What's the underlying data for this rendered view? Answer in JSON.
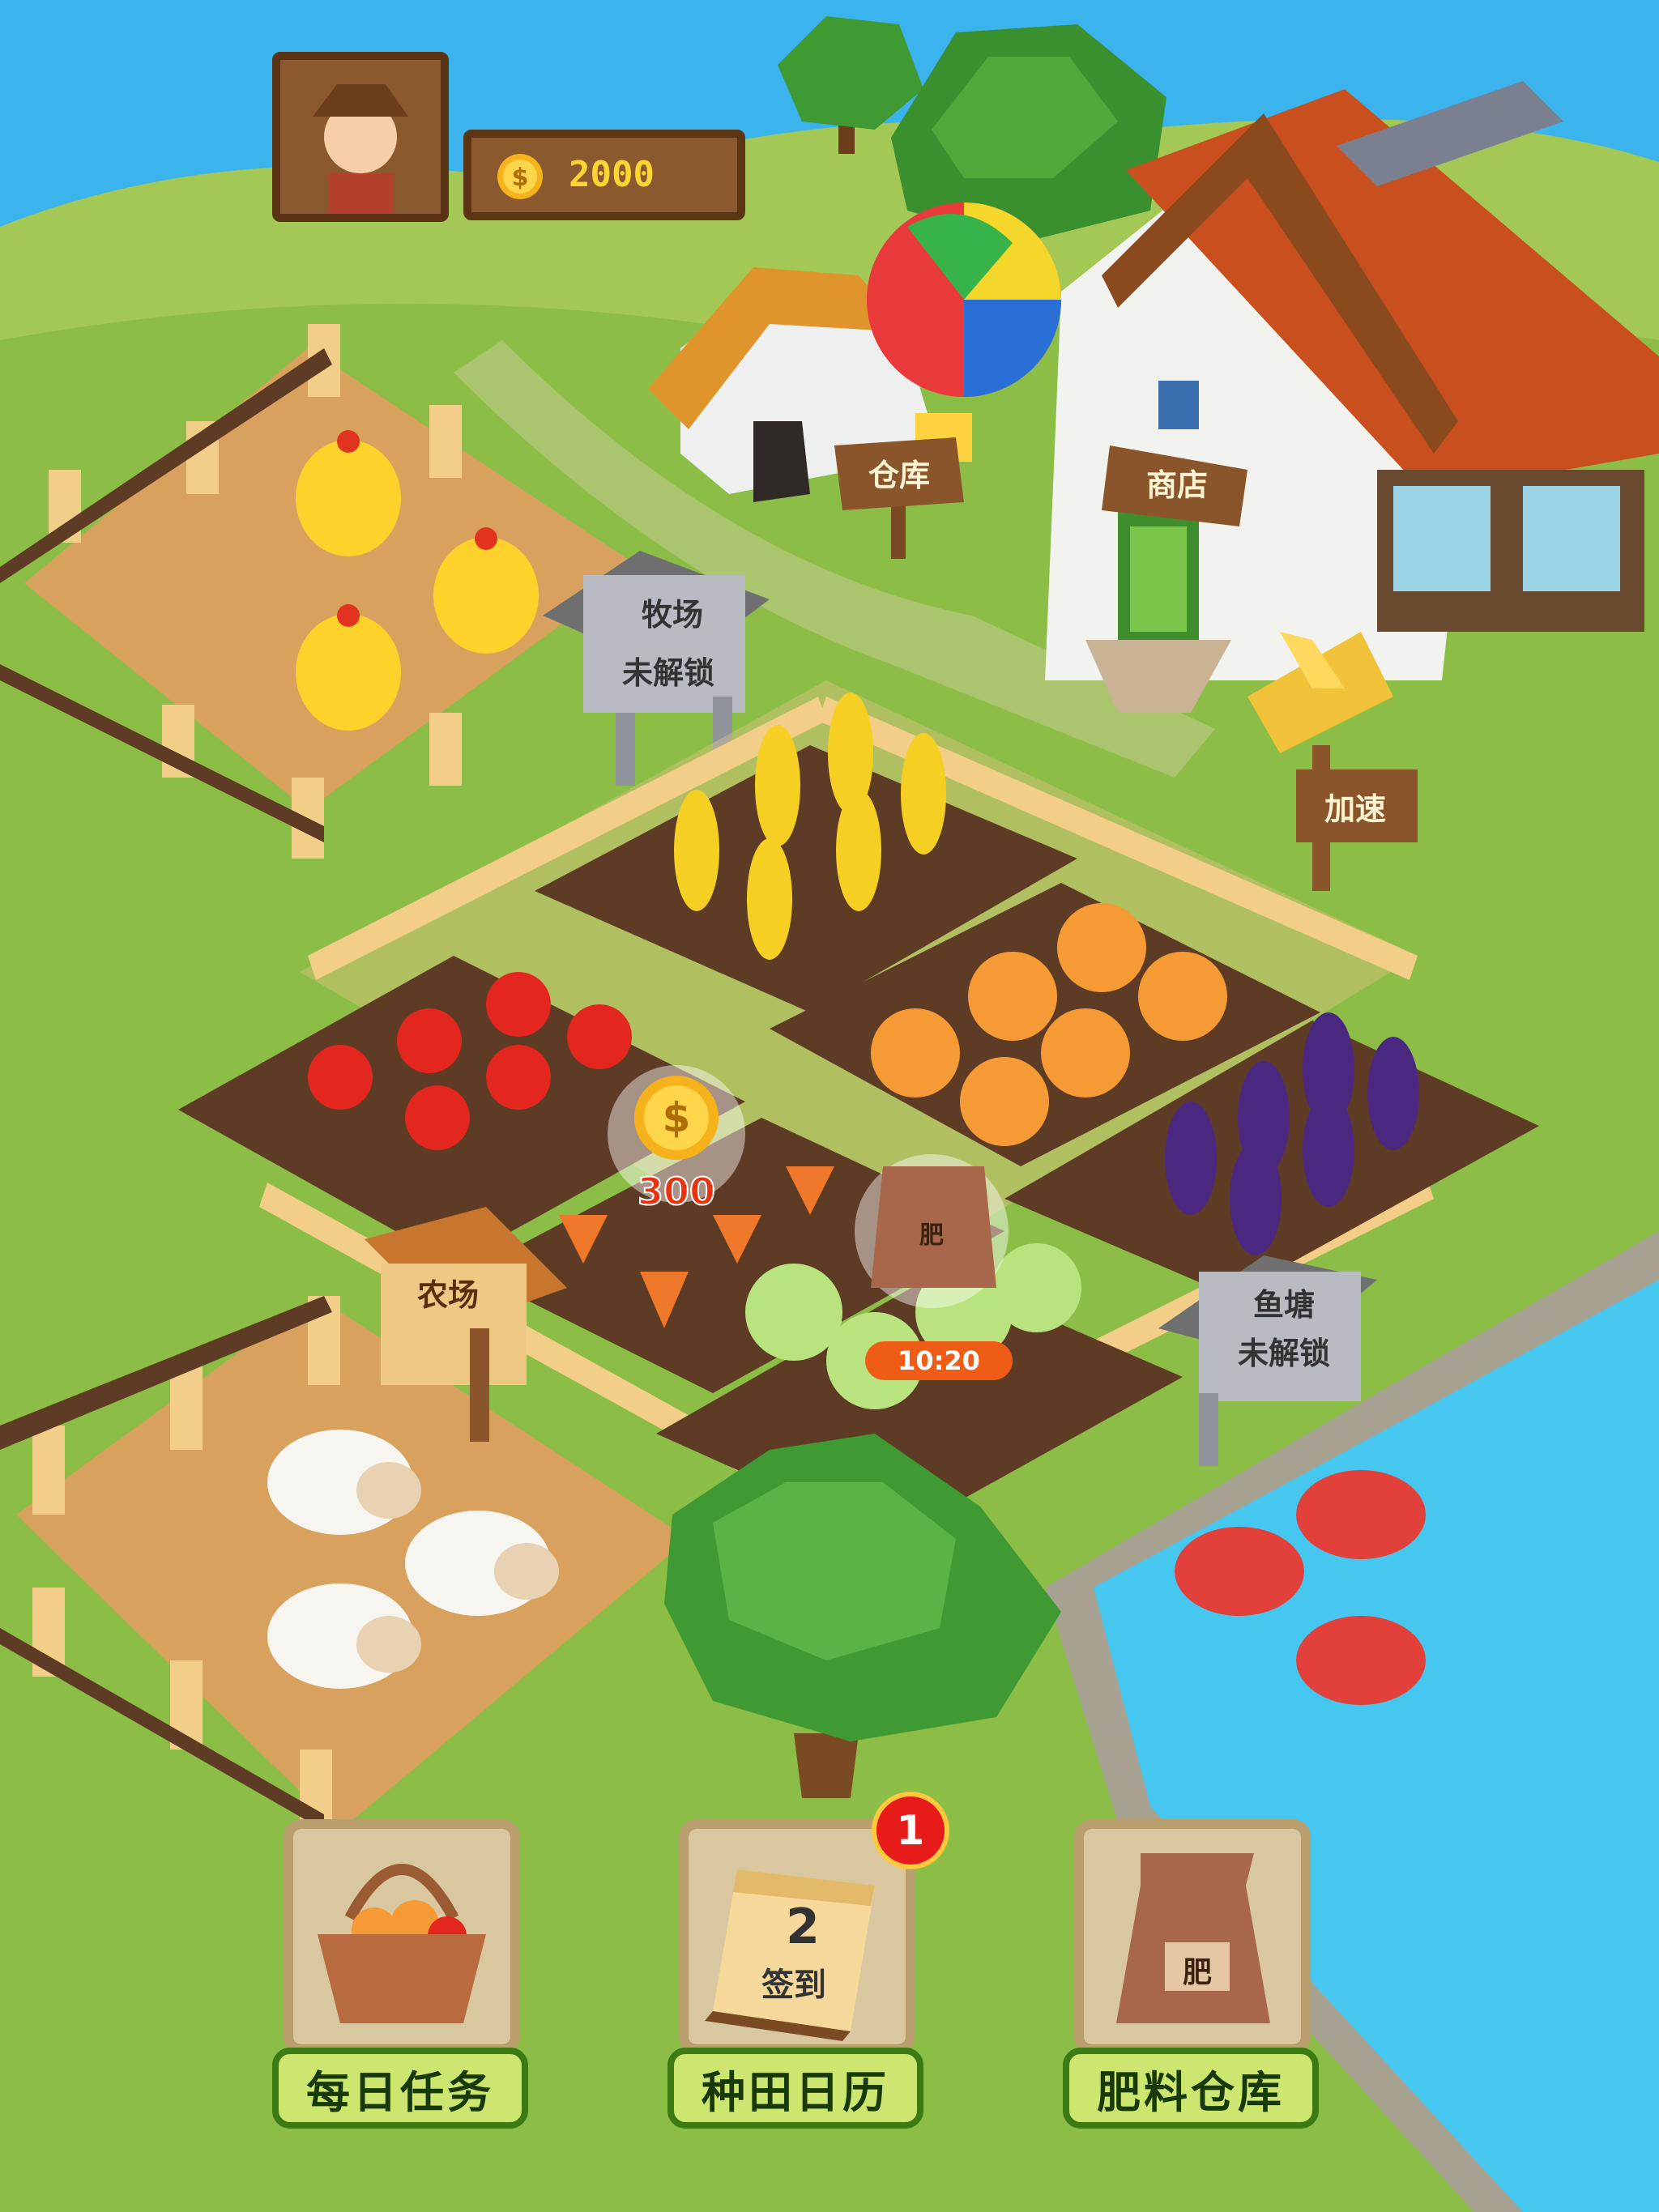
{
  "hud": {
    "coins": "2000",
    "coin_icon": "coin-icon",
    "avatar_icon": "farmer-avatar-icon"
  },
  "buildings": {
    "warehouse_label": "仓库",
    "shop_label": "商店",
    "speedup_label": "加速"
  },
  "locked_areas": {
    "ranch": {
      "title": "牧场",
      "status": "未解锁"
    },
    "fishpond": {
      "title": "鱼塘",
      "status": "未解锁"
    }
  },
  "farm_sign": "农场",
  "harvest": {
    "coin_reward": "300",
    "fertilizer_bag_label": "肥",
    "timer": "10:20"
  },
  "bottom_menu": {
    "daily_tasks": {
      "label": "每日任务",
      "icon": "basket-icon"
    },
    "farm_calendar": {
      "label": "种田日历",
      "icon": "calendar-icon",
      "calendar_day": "2",
      "calendar_text": "签到",
      "badge": "1"
    },
    "fertilizer_storage": {
      "label": "肥料仓库",
      "icon": "fertilizer-bag-icon",
      "bag_text": "肥"
    }
  },
  "colors": {
    "sky": "#3bb3ec",
    "grass": "#8bbd47",
    "water": "#46c7f0",
    "soil": "#5e3b24",
    "button_green": "#cde670"
  }
}
